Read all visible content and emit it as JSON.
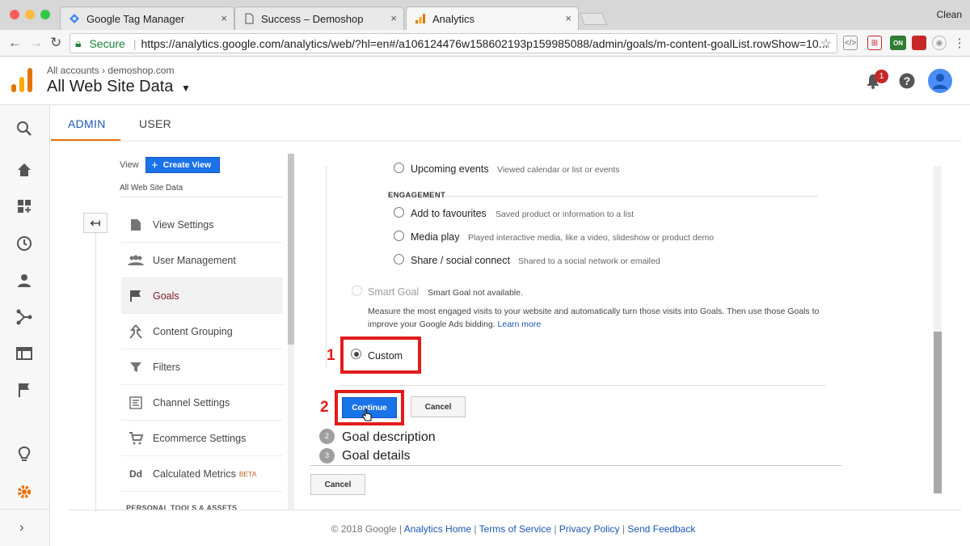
{
  "browser": {
    "tabs": [
      {
        "title": "Google Tag Manager",
        "close": "×"
      },
      {
        "title": "Success – Demoshop",
        "close": "×"
      },
      {
        "title": "Analytics",
        "close": "×"
      }
    ],
    "profile": "Clean",
    "secure_label": "Secure",
    "url": "https://analytics.google.com/analytics/web/?hl=en#/a106124476w158602193p159985088/admin/goals/m-content-goalList.rowShow=10...",
    "colors": {
      "traffic_red": "#fc605c",
      "traffic_yellow": "#fcbb40",
      "traffic_green": "#34c84a"
    },
    "extension_on_label": "ON"
  },
  "header": {
    "breadcrumb_root": "All accounts",
    "breadcrumb_sep": "›",
    "breadcrumb_property": "demoshop.com",
    "view_title": "All Web Site Data",
    "notification_count": "1"
  },
  "tabs": {
    "admin": "ADMIN",
    "user": "USER"
  },
  "admin_column": {
    "view_label": "View",
    "create_view": "Create View",
    "view_name": "All Web Site Data",
    "menu": [
      {
        "label": "View Settings",
        "icon": "document-icon"
      },
      {
        "label": "User Management",
        "icon": "people-icon"
      },
      {
        "label": "Goals",
        "icon": "flag-icon"
      },
      {
        "label": "Content Grouping",
        "icon": "content-grouping-icon"
      },
      {
        "label": "Filters",
        "icon": "filter-icon"
      },
      {
        "label": "Channel Settings",
        "icon": "channel-icon"
      },
      {
        "label": "Ecommerce Settings",
        "icon": "cart-icon"
      },
      {
        "label": "Calculated Metrics",
        "icon": "dd-icon",
        "badge": "BETA"
      }
    ],
    "personal_section": "PERSONAL TOOLS & ASSETS"
  },
  "goal_setup": {
    "top_option": {
      "label": "Upcoming events",
      "desc": "Viewed calendar or list or events"
    },
    "engagement_title": "ENGAGEMENT",
    "engagement_options": [
      {
        "label": "Add to favourites",
        "desc": "Saved product or information to a list"
      },
      {
        "label": "Media play",
        "desc": "Played interactive media, like a video, slideshow or product demo"
      },
      {
        "label": "Share / social connect",
        "desc": "Shared to a social network or emailed"
      }
    ],
    "smart_goal": {
      "label": "Smart Goal",
      "status": "Smart Goal not available.",
      "text": "Measure the most engaged visits to your website and automatically turn those visits into Goals. Then use those Goals to improve your Google Ads bidding.",
      "link": "Learn more"
    },
    "custom_label": "Custom",
    "continue": "Continue",
    "cancel": "Cancel",
    "steps": [
      {
        "num": "2",
        "title": "Goal description"
      },
      {
        "num": "3",
        "title": "Goal details"
      }
    ],
    "bottom_cancel": "Cancel"
  },
  "annotations": {
    "step1": "1",
    "step2": "2",
    "color": "#e21c1c"
  },
  "footer": {
    "copyright": "© 2018 Google",
    "sep": " | ",
    "links": [
      "Analytics Home",
      "Terms of Service",
      "Privacy Policy",
      "Send Feedback"
    ]
  }
}
